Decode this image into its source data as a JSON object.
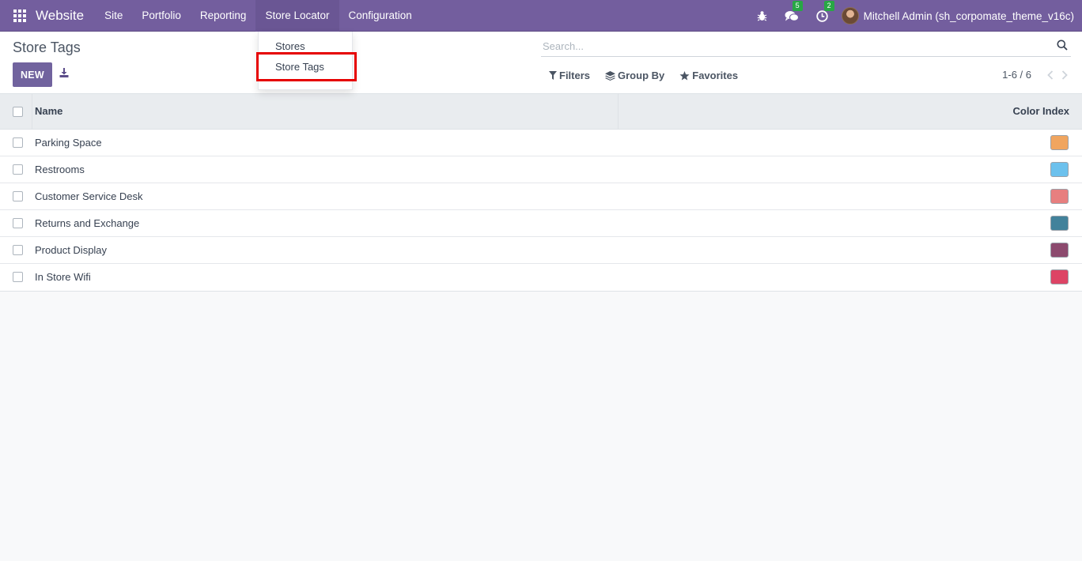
{
  "navbar": {
    "brand": "Website",
    "menu": [
      "Site",
      "Portfolio",
      "Reporting",
      "Store Locator",
      "Configuration"
    ],
    "active_menu": "Store Locator",
    "messages_count": "5",
    "activities_count": "2",
    "user": "Mitchell Admin (sh_corpomate_theme_v16c)",
    "color": "#735e9e"
  },
  "dropdown": {
    "items": [
      "Stores",
      "Store Tags"
    ],
    "highlighted": "Store Tags",
    "highlight_color": "#e60000"
  },
  "control_panel": {
    "title": "Store Tags",
    "new_label": "NEW",
    "search_placeholder": "Search...",
    "filters_label": "Filters",
    "group_by_label": "Group By",
    "favorites_label": "Favorites",
    "pager": "1-6 / 6"
  },
  "list": {
    "columns": [
      "Name",
      "Color Index"
    ],
    "rows": [
      {
        "name": "Parking Space",
        "color": "#f0a55f"
      },
      {
        "name": "Restrooms",
        "color": "#6cc1ed"
      },
      {
        "name": "Customer Service Desk",
        "color": "#e77f7f"
      },
      {
        "name": "Returns and Exchange",
        "color": "#42829b"
      },
      {
        "name": "Product Display",
        "color": "#8c4a6e"
      },
      {
        "name": "In Store Wifi",
        "color": "#dd4465"
      }
    ]
  }
}
